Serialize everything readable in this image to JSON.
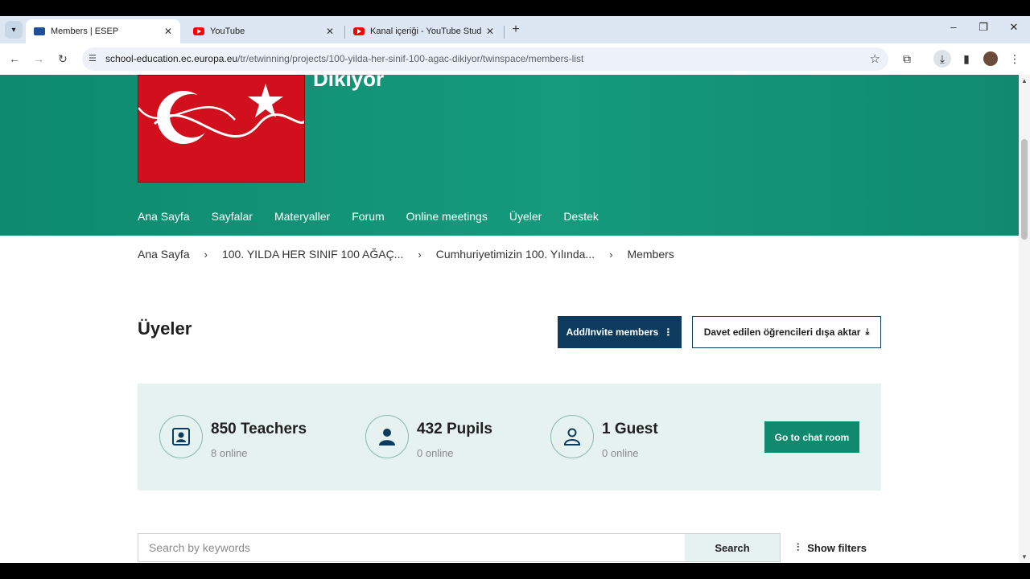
{
  "browser": {
    "tabs": [
      {
        "label": "Members | ESEP",
        "active": true
      },
      {
        "label": "YouTube",
        "active": false
      },
      {
        "label": "Kanal içeriği - YouTube Studio",
        "active": false
      }
    ],
    "url_host": "school-education.ec.europa.eu",
    "url_path": "/tr/etwinning/projects/100-yilda-her-sinif-100-agac-dikiyor/twinspace/members-list",
    "icons": {
      "tab_menu": "chevron-down-icon",
      "close": "close-icon",
      "new_tab": "plus-icon",
      "back": "arrow-left-icon",
      "forward": "arrow-right-icon",
      "reload": "reload-icon",
      "site_info": "tune-icon",
      "bookmark": "star-icon",
      "extensions": "puzzle-icon",
      "downloads": "download-icon",
      "side_panel": "side-panel-icon",
      "menu": "kebab-menu-icon"
    }
  },
  "hero": {
    "title": "Dikiyor",
    "nav": [
      "Ana Sayfa",
      "Sayfalar",
      "Materyaller",
      "Forum",
      "Online meetings",
      "Üyeler",
      "Destek"
    ],
    "active_nav": "Üyeler",
    "color": "#0f8a6e"
  },
  "breadcrumb": [
    "Ana Sayfa",
    "100. YILDA HER SINIF 100 AĞAÇ...",
    "Cumhuriyetimizin 100. Yılında...",
    "Members"
  ],
  "page": {
    "title": "Üyeler",
    "add_invite_label": "Add/Invite members",
    "export_label": "Davet edilen öğrencileri dışa aktar"
  },
  "stats": [
    {
      "count": "850 Teachers",
      "online": "8 online",
      "icon": "teacher-badge-icon"
    },
    {
      "count": "432 Pupils",
      "online": "0 online",
      "icon": "person-filled-icon"
    },
    {
      "count": "1 Guest",
      "online": "0 online",
      "icon": "person-outline-icon"
    }
  ],
  "chat_label": "Go to chat room",
  "search": {
    "placeholder": "Search by keywords",
    "button": "Search",
    "filters_label": "Show filters"
  },
  "colors": {
    "primary_dark": "#0c3b5e",
    "green": "#0f8a6e",
    "panel": "#e6f2ef"
  }
}
